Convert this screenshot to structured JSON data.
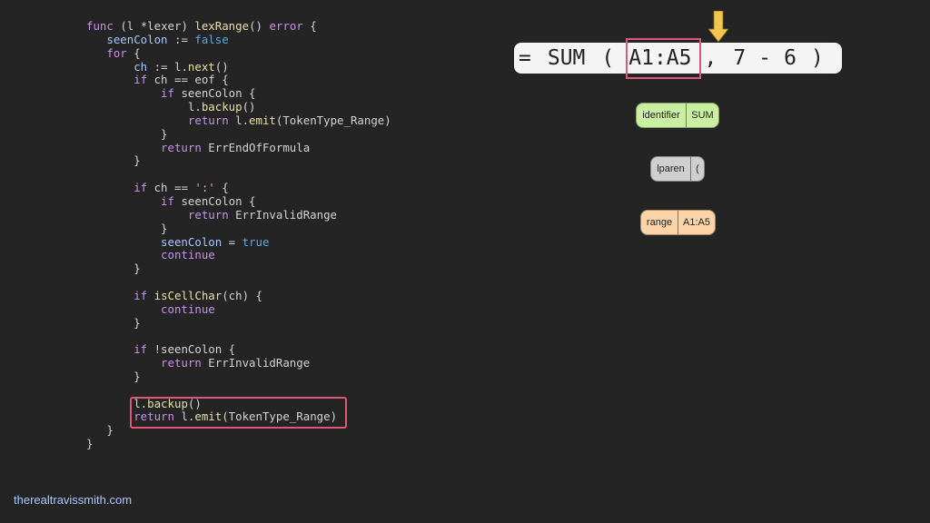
{
  "code_lines": [
    [
      {
        "t": "func ",
        "c": "kw"
      },
      {
        "t": "(l *lexer) ",
        "c": ""
      },
      {
        "t": "lexRange",
        "c": "fn"
      },
      {
        "t": "() ",
        "c": ""
      },
      {
        "t": "error",
        "c": "kw"
      },
      {
        "t": " {",
        "c": ""
      }
    ],
    [
      {
        "t": "   seenColon",
        "c": "var"
      },
      {
        "t": " := ",
        "c": ""
      },
      {
        "t": "false",
        "c": "lit"
      }
    ],
    [
      {
        "t": "   for",
        "c": "kw"
      },
      {
        "t": " {",
        "c": ""
      }
    ],
    [
      {
        "t": "       ch",
        "c": "var"
      },
      {
        "t": " := l.",
        "c": ""
      },
      {
        "t": "next",
        "c": "fn"
      },
      {
        "t": "()",
        "c": ""
      }
    ],
    [
      {
        "t": "       if",
        "c": "kw"
      },
      {
        "t": " ch == eof {",
        "c": ""
      }
    ],
    [
      {
        "t": "           if",
        "c": "kw"
      },
      {
        "t": " seenColon {",
        "c": ""
      }
    ],
    [
      {
        "t": "               l.",
        "c": ""
      },
      {
        "t": "backup",
        "c": "fn"
      },
      {
        "t": "()",
        "c": ""
      }
    ],
    [
      {
        "t": "               return",
        "c": "kw"
      },
      {
        "t": " l.",
        "c": ""
      },
      {
        "t": "emit",
        "c": "fn"
      },
      {
        "t": "(TokenType_Range)",
        "c": ""
      }
    ],
    [
      {
        "t": "           }",
        "c": ""
      }
    ],
    [
      {
        "t": "           return",
        "c": "kw"
      },
      {
        "t": " ErrEndOfFormula",
        "c": ""
      }
    ],
    [
      {
        "t": "       }",
        "c": ""
      }
    ],
    [
      {
        "t": "",
        "c": ""
      }
    ],
    [
      {
        "t": "       if",
        "c": "kw"
      },
      {
        "t": " ch == ",
        "c": ""
      },
      {
        "t": "':'",
        "c": "str"
      },
      {
        "t": " {",
        "c": ""
      }
    ],
    [
      {
        "t": "           if",
        "c": "kw"
      },
      {
        "t": " seenColon {",
        "c": ""
      }
    ],
    [
      {
        "t": "               return",
        "c": "kw"
      },
      {
        "t": " ErrInvalidRange",
        "c": ""
      }
    ],
    [
      {
        "t": "           }",
        "c": ""
      }
    ],
    [
      {
        "t": "           seenColon",
        "c": "var"
      },
      {
        "t": " = ",
        "c": ""
      },
      {
        "t": "true",
        "c": "lit"
      }
    ],
    [
      {
        "t": "           continue",
        "c": "kw"
      }
    ],
    [
      {
        "t": "       }",
        "c": ""
      }
    ],
    [
      {
        "t": "",
        "c": ""
      }
    ],
    [
      {
        "t": "       if",
        "c": "kw"
      },
      {
        "t": " ",
        "c": ""
      },
      {
        "t": "isCellChar",
        "c": "fn"
      },
      {
        "t": "(ch) {",
        "c": ""
      }
    ],
    [
      {
        "t": "           continue",
        "c": "kw"
      }
    ],
    [
      {
        "t": "       }",
        "c": ""
      }
    ],
    [
      {
        "t": "",
        "c": ""
      }
    ],
    [
      {
        "t": "       if",
        "c": "kw"
      },
      {
        "t": " !seenColon {",
        "c": ""
      }
    ],
    [
      {
        "t": "           return",
        "c": "kw"
      },
      {
        "t": " ErrInvalidRange",
        "c": ""
      }
    ],
    [
      {
        "t": "       }",
        "c": ""
      }
    ],
    [
      {
        "t": "",
        "c": ""
      }
    ],
    [
      {
        "t": "       l.",
        "c": ""
      },
      {
        "t": "backup",
        "c": "fn"
      },
      {
        "t": "()",
        "c": ""
      }
    ],
    [
      {
        "t": "       return",
        "c": "kw"
      },
      {
        "t": " l.",
        "c": ""
      },
      {
        "t": "emit",
        "c": "fn"
      },
      {
        "t": "(TokenType_Range)",
        "c": ""
      }
    ],
    [
      {
        "t": "   }",
        "c": ""
      }
    ],
    [
      {
        "t": "}",
        "c": ""
      }
    ]
  ],
  "formula": {
    "eq": "=",
    "func": "SUM",
    "lparen": "(",
    "range": "A1:A5",
    "comma": ",",
    "n1": "7",
    "op": "-",
    "n2": "6",
    "rparen": ")"
  },
  "tokens": {
    "identifier": {
      "type": "identifier",
      "value": "SUM",
      "color": "#c9f0a0"
    },
    "lparen": {
      "type": "lparen",
      "value": "(",
      "color": "#cfcfcf"
    },
    "range": {
      "type": "range",
      "value": "A1:A5",
      "color": "#fcd4a8"
    }
  },
  "arrow_icon": "down-arrow-icon",
  "accent_color": "#e0567a",
  "arrow_color": "#f3c54c",
  "footer": "therealtravissmith.com"
}
